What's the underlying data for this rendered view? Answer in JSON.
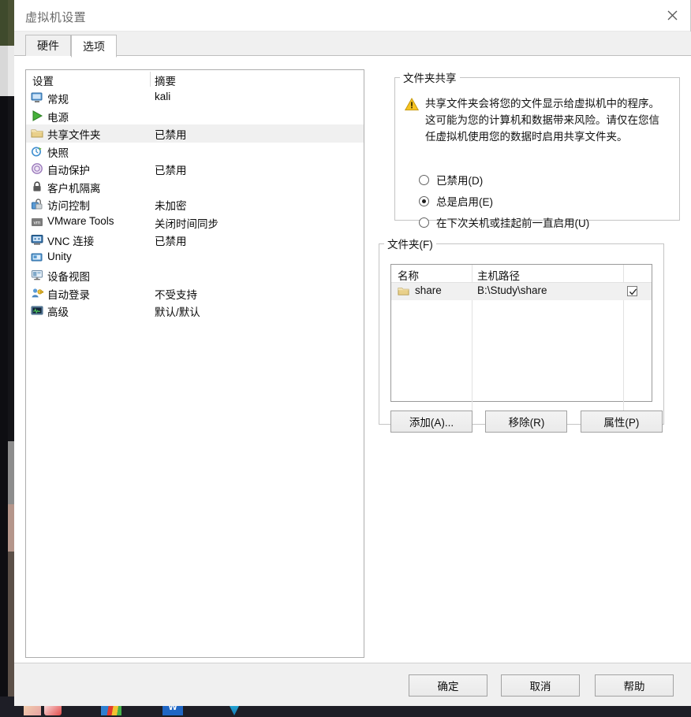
{
  "window": {
    "title": "虚拟机设置",
    "close_icon": "close-icon"
  },
  "tabs": [
    {
      "label": "硬件",
      "active": false
    },
    {
      "label": "选项",
      "active": true
    }
  ],
  "settings_list": {
    "headers": {
      "name": "设置",
      "summary": "摘要"
    },
    "rows": [
      {
        "icon": "monitor-icon",
        "name": "常规",
        "summary": "kali",
        "selected": false
      },
      {
        "icon": "power-icon",
        "name": "电源",
        "summary": "",
        "selected": false
      },
      {
        "icon": "folder-icon",
        "name": "共享文件夹",
        "summary": "已禁用",
        "selected": true
      },
      {
        "icon": "snapshot-icon",
        "name": "快照",
        "summary": "",
        "selected": false
      },
      {
        "icon": "autoprotect-icon",
        "name": "自动保护",
        "summary": "已禁用",
        "selected": false
      },
      {
        "icon": "lock-icon",
        "name": "客户机隔离",
        "summary": "",
        "selected": false
      },
      {
        "icon": "access-control-icon",
        "name": "访问控制",
        "summary": "未加密",
        "selected": false
      },
      {
        "icon": "vmware-tools-icon",
        "name": "VMware Tools",
        "summary": "关闭时间同步",
        "selected": false
      },
      {
        "icon": "vnc-icon",
        "name": "VNC 连接",
        "summary": "已禁用",
        "selected": false
      },
      {
        "icon": "unity-icon",
        "name": "Unity",
        "summary": "",
        "selected": false
      },
      {
        "icon": "device-view-icon",
        "name": "设备视图",
        "summary": "",
        "selected": false
      },
      {
        "icon": "autologon-icon",
        "name": "自动登录",
        "summary": "不受支持",
        "selected": false
      },
      {
        "icon": "advanced-icon",
        "name": "高级",
        "summary": "默认/默认",
        "selected": false
      }
    ]
  },
  "folder_sharing": {
    "legend": "文件夹共享",
    "warning_icon": "warning-icon",
    "warning_text": "共享文件夹会将您的文件显示给虚拟机中的程序。这可能为您的计算机和数据带来风险。请仅在您信任虚拟机使用您的数据时启用共享文件夹。",
    "options": [
      {
        "label": "已禁用(D)",
        "selected": false
      },
      {
        "label": "总是启用(E)",
        "selected": true
      },
      {
        "label": "在下次关机或挂起前一直启用(U)",
        "selected": false
      }
    ]
  },
  "folders": {
    "legend": "文件夹(F)",
    "headers": {
      "name": "名称",
      "host_path": "主机路径",
      "enabled": ""
    },
    "rows": [
      {
        "icon": "folder-icon",
        "name": "share",
        "host_path": "B:\\Study\\share",
        "enabled": true
      }
    ],
    "buttons": {
      "add": "添加(A)...",
      "remove": "移除(R)",
      "properties": "属性(P)"
    }
  },
  "footer": {
    "ok": "确定",
    "cancel": "取消",
    "help": "帮助"
  },
  "colors": {
    "selection": "#f0f0f0",
    "folder_yellow": "#e8c66a",
    "warning_yellow": "#f5c518",
    "accent_blue": "#3a7cc4",
    "power_green": "#3fa72f"
  }
}
